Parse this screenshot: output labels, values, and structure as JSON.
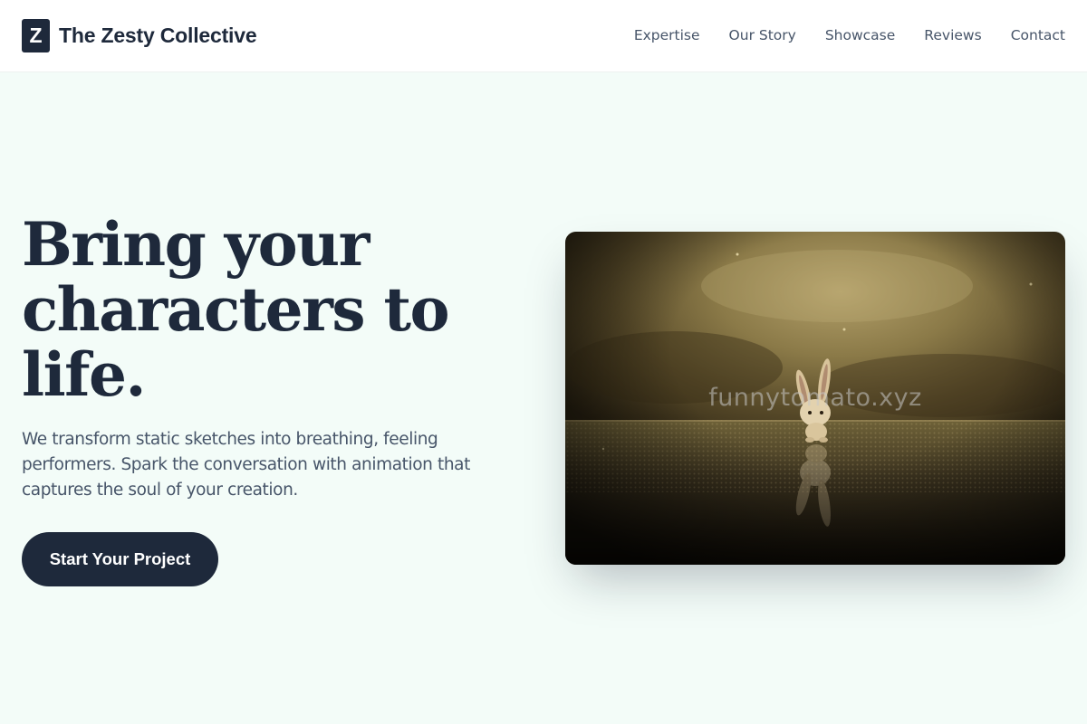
{
  "brand": {
    "logo_letter": "Z",
    "name": "The Zesty Collective"
  },
  "nav": {
    "items": [
      "Expertise",
      "Our Story",
      "Showcase",
      "Reviews",
      "Contact"
    ]
  },
  "hero": {
    "title": "Bring your characters to life.",
    "subtitle": "We transform static sketches into breathing, feeling performers. Spark the conversation with animation that captures the soul of your creation.",
    "cta_label": "Start Your Project",
    "image": {
      "icon": "bunny-figurine-image",
      "watermark": "funnytomato.xyz"
    }
  },
  "colors": {
    "background": "#f3fcf8",
    "primary": "#1e293b",
    "text_muted": "#475569",
    "header_bg": "#ffffff"
  }
}
